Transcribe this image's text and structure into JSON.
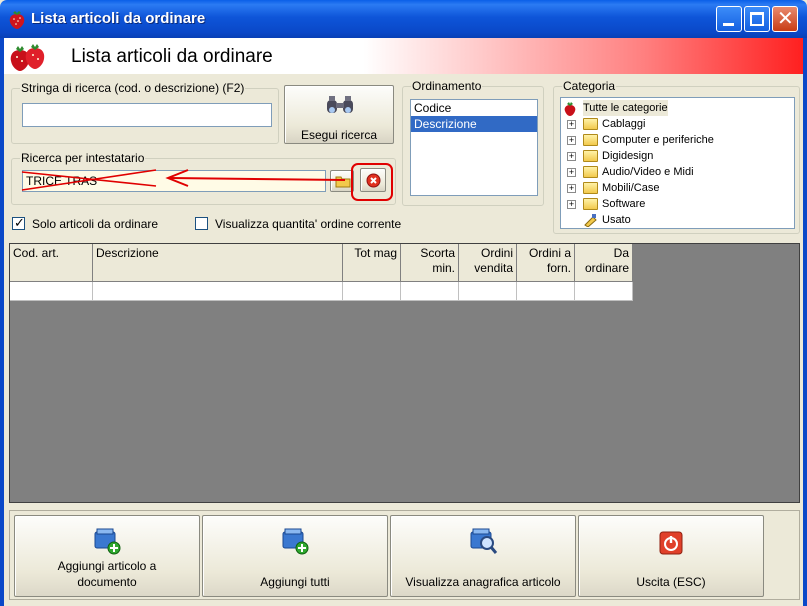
{
  "window": {
    "title": "Lista articoli da ordinare"
  },
  "header": {
    "heading": "Lista articoli da ordinare"
  },
  "search": {
    "legend": "Stringa di ricerca (cod. o descrizione) (F2)",
    "value": "",
    "button_label": "Esegui ricerca",
    "button_icon": "binoculars-icon"
  },
  "owner_search": {
    "legend": "Ricerca per intestatario",
    "value": "TRICE TRAS",
    "browse_icon": "folder-open-icon",
    "clear_icon": "clear-red-icon"
  },
  "sorting": {
    "legend": "Ordinamento",
    "options": [
      "Codice",
      "Descrizione"
    ],
    "selected": "Descrizione"
  },
  "category": {
    "legend": "Categoria",
    "root": "Tutte le categorie",
    "items": [
      "Cablaggi",
      "Computer e periferiche",
      "Digidesign",
      "Audio/Video e Midi",
      "Mobili/Case",
      "Software",
      "Usato"
    ]
  },
  "options": {
    "only_to_order": {
      "label": "Solo articoli da ordinare",
      "checked": true
    },
    "show_order_qty": {
      "label": "Visualizza quantita' ordine corrente",
      "checked": false
    }
  },
  "grid": {
    "columns": [
      "Cod. art.",
      "Descrizione",
      "Tot mag",
      "Scorta min.",
      "Ordini vendita",
      "Ordini a forn.",
      "Da ordinare"
    ]
  },
  "actions": {
    "add_to_doc": "Aggiungi articolo a documento",
    "add_all": "Aggiungi tutti",
    "view_registry": "Visualizza anagrafica articolo",
    "exit": "Uscita (ESC)"
  },
  "colors": {
    "selection": "#316ac5",
    "titlebar": "#0a48c8",
    "annotation": "#e00000"
  }
}
